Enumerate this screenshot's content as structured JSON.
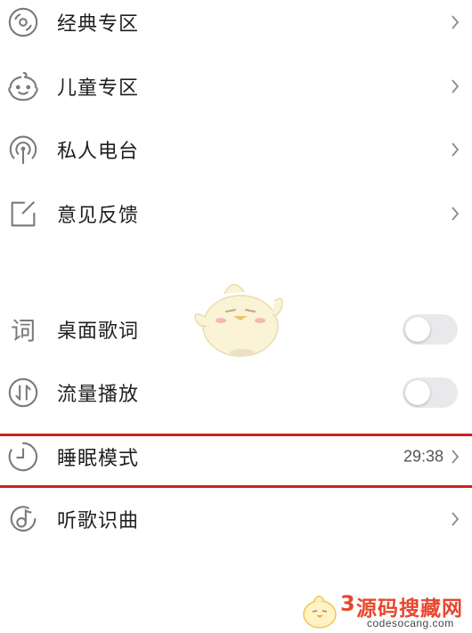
{
  "menu": {
    "classic": {
      "label": "经典专区",
      "icon": "vinyl-disc-icon"
    },
    "kids": {
      "label": "儿童专区",
      "icon": "child-face-icon"
    },
    "radio": {
      "label": "私人电台",
      "icon": "radio-broadcast-icon"
    },
    "feedback": {
      "label": "意见反馈",
      "icon": "edit-note-icon"
    },
    "desktop_lyrics": {
      "label": "桌面歌词",
      "icon_text": "词",
      "toggle_on": false
    },
    "data_playback": {
      "label": "流量播放",
      "icon": "data-traffic-icon",
      "toggle_on": false
    },
    "sleep_mode": {
      "label": "睡眠模式",
      "icon": "timer-clock-icon",
      "value": "29:38"
    },
    "song_recognition": {
      "label": "听歌识曲",
      "icon": "music-note-icon"
    }
  },
  "watermark": {
    "logo_text": "源码搜藏网",
    "number": "3",
    "url": "codesocang.com"
  },
  "colors": {
    "highlight": "#c9221d",
    "icon_gray": "#7a7a7a",
    "toggle_off": "#e9e9ec",
    "watermark": "#e8472e"
  }
}
